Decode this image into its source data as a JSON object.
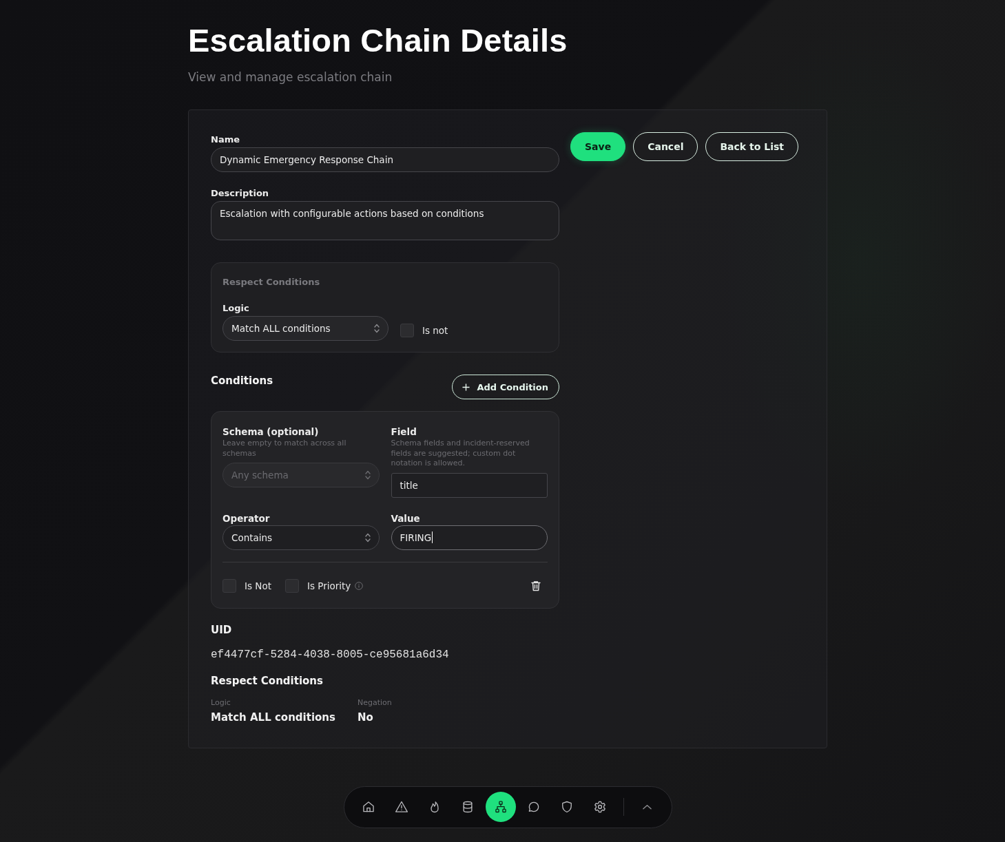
{
  "header": {
    "title": "Escalation Chain Details",
    "subtitle": "View and manage escalation chain"
  },
  "actions": [
    {
      "label": "Save",
      "kind": "primary"
    },
    {
      "label": "Cancel",
      "kind": "outline"
    },
    {
      "label": "Back to List",
      "kind": "outline"
    }
  ],
  "form": {
    "name": {
      "label": "Name",
      "value": "Dynamic Emergency Response Chain"
    },
    "description": {
      "label": "Description",
      "value": "Escalation with configurable actions based on conditions"
    }
  },
  "respect_panel": {
    "title": "Respect Conditions",
    "logic": {
      "label": "Logic",
      "value": "Match ALL conditions"
    },
    "is_not": {
      "label": "Is not",
      "checked": false
    }
  },
  "conditions": {
    "title": "Conditions",
    "add_button": "Add Condition",
    "items": [
      {
        "schema": {
          "label": "Schema (optional)",
          "hint": "Leave empty to match across all schemas",
          "placeholder": "Any schema"
        },
        "field": {
          "label": "Field",
          "hint": "Schema fields and incident-reserved fields are suggested; custom dot notation is allowed.",
          "value": "title"
        },
        "operator": {
          "label": "Operator",
          "value": "Contains"
        },
        "value": {
          "label": "Value",
          "value": "FIRING",
          "focused": true
        },
        "is_not": {
          "label": "Is Not",
          "checked": false
        },
        "is_priority": {
          "label": "Is Priority",
          "checked": false
        }
      }
    ]
  },
  "uid": {
    "label": "UID",
    "value": "ef4477cf-5284-4038-8005-ce95681a6d34"
  },
  "summary": {
    "title": "Respect Conditions",
    "items": [
      {
        "label": "Logic",
        "value": "Match ALL conditions"
      },
      {
        "label": "Negation",
        "value": "No"
      }
    ]
  },
  "dock": {
    "items": [
      {
        "kind": "home",
        "selected": false
      },
      {
        "kind": "warning",
        "selected": false
      },
      {
        "kind": "flame",
        "selected": false
      },
      {
        "kind": "database",
        "selected": false
      },
      {
        "kind": "hierarchy",
        "selected": true
      },
      {
        "kind": "chat",
        "selected": false
      },
      {
        "kind": "shield",
        "selected": false
      },
      {
        "kind": "settings",
        "selected": false
      }
    ]
  }
}
